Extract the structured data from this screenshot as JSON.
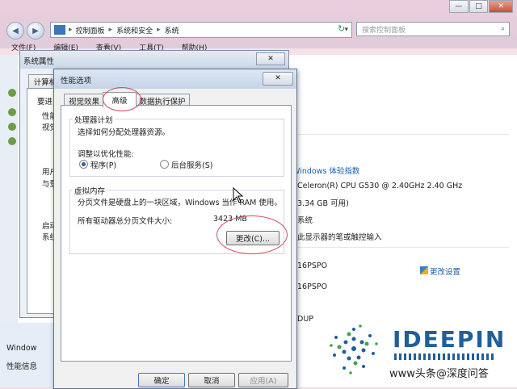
{
  "explorer": {
    "breadcrumb": [
      "控制面板",
      "系统和安全",
      "系统"
    ],
    "search_placeholder": "搜索控制面板",
    "menu": [
      "文件(F)",
      "编辑(E)",
      "查看(V)",
      "工具(T)",
      "帮助(H)"
    ],
    "windows_experience": "Windows 体验指数",
    "processor": "Celeron(R) CPU G530 @ 2.40GHz   2.40 GHz",
    "ram": "3.34 GB 可用)",
    "system_type": "系统",
    "pen_touch": "此显示器的笔或触控输入",
    "computer_name_1": "16PSPO",
    "change_settings": "更改设置",
    "computer_name_2": "16PSPO",
    "workgroup_tail": "DUP",
    "left_bottom_1": "Window",
    "left_bottom_2": "性能信息"
  },
  "sysprops": {
    "title": "系统属性",
    "tab_label": "计算机",
    "partial_lines": [
      "要进",
      "性能",
      "视觉",
      "用户",
      "与登",
      "启动",
      "系统"
    ]
  },
  "perf": {
    "title": "性能选项",
    "tabs": [
      "视觉效果",
      "高级",
      "数据执行保护"
    ],
    "processor_group": {
      "legend": "处理器计划",
      "desc": "选择如何分配处理器资源。",
      "adjust_label": "调整以优化性能:",
      "options": [
        "程序(P)",
        "后台服务(S)"
      ],
      "selected": "程序(P)"
    },
    "vm_group": {
      "legend": "虚拟内存",
      "desc": "分页文件是硬盘上的一块区域，Windows 当作 RAM 使用。",
      "total_label": "所有驱动器总分页文件大小:",
      "total_value": "3423 MB",
      "change_button": "更改(C)..."
    },
    "buttons": {
      "ok": "确定",
      "cancel": "取消",
      "apply": "应用(A)"
    }
  },
  "branding": {
    "logo_text": "IDEEPIN",
    "watermark": "www头条@深度问答"
  },
  "colors": {
    "accent": "#1a5fb4",
    "annotation_red": "#d04a5c"
  }
}
